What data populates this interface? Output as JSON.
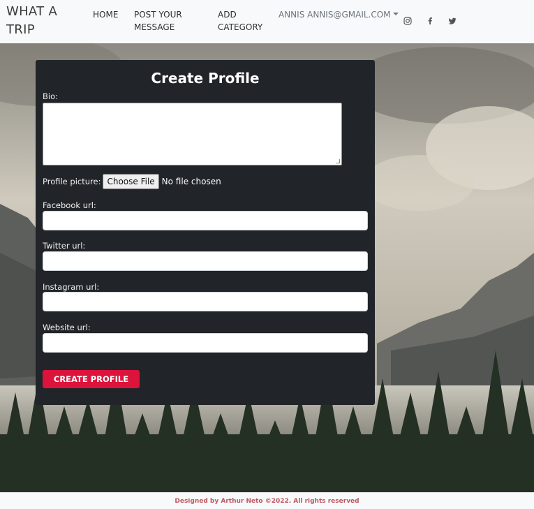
{
  "navbar": {
    "brand": "WHAT A TRIP",
    "links": [
      {
        "label": "HOME"
      },
      {
        "label": "POST YOUR MESSAGE"
      },
      {
        "label": "ADD CATEGORY"
      }
    ],
    "user_menu": "ANNIS ANNIS@GMAIL.COM",
    "social": [
      {
        "icon": "instagram-icon"
      },
      {
        "icon": "facebook-icon"
      },
      {
        "icon": "twitter-icon"
      }
    ]
  },
  "form": {
    "title": "Create Profile",
    "bio_label": "Bio:",
    "bio_value": "",
    "picture_label": "Profile picture:",
    "file_button": "Choose File",
    "file_status": "No file chosen",
    "facebook_label": "Facebook url:",
    "facebook_value": "",
    "twitter_label": "Twitter url:",
    "twitter_value": "",
    "instagram_label": "Instagram url:",
    "instagram_value": "",
    "website_label": "Website url:",
    "website_value": "",
    "submit_label": "CREATE PROFILE"
  },
  "footer": {
    "text": "Designed by Arthur Neto ©2022. All rights reserved"
  },
  "colors": {
    "accent": "#dc143c",
    "card_bg": "#212529",
    "footer_text": "#c0565f"
  }
}
